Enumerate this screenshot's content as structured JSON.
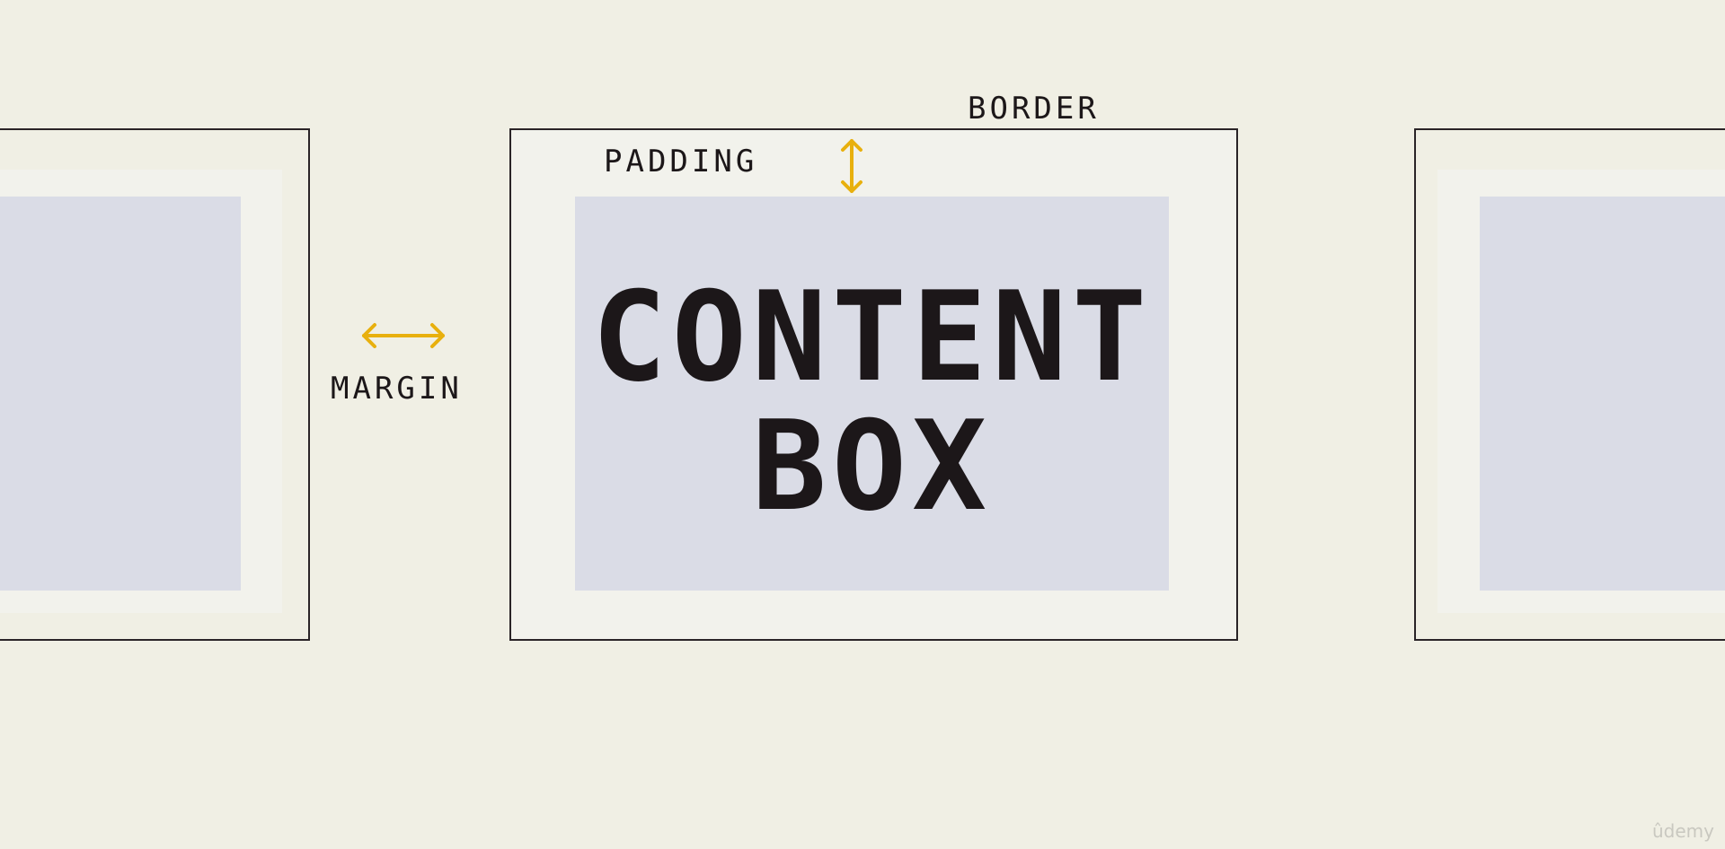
{
  "labels": {
    "border": "BORDER",
    "padding": "PADDING",
    "margin": "MARGIN"
  },
  "content_box": {
    "line1": "CONTENT",
    "line2": "BOX"
  },
  "watermark": "ûdemy",
  "colors": {
    "background": "#f0efe4",
    "padding": "#f2f2ec",
    "content": "#dadce6",
    "border": "#2a2427",
    "arrow": "#e8b00e",
    "text": "#1c1719"
  },
  "icons": {
    "padding_arrow": "vertical-double-arrow-icon",
    "margin_arrow": "horizontal-double-arrow-icon"
  }
}
